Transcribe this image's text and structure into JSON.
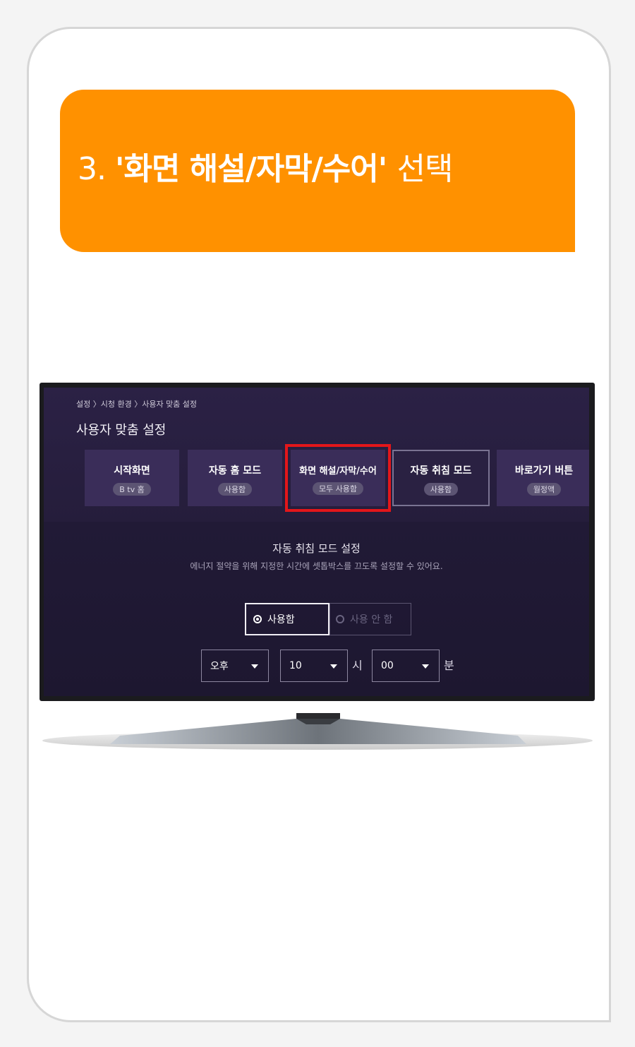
{
  "banner": {
    "number": "3. ",
    "quote_open": "'",
    "bold_text": "화면 해설/자막/수어",
    "quote_close": "' ",
    "action": "선택",
    "color": "#ff9100"
  },
  "tv": {
    "breadcrumb": "설정 〉시청 환경 〉사용자 맞춤 설정",
    "title": "사용자 맞춤 설정",
    "tiles": [
      {
        "label": "시작화면",
        "badge": "B tv 홈"
      },
      {
        "label": "자동 홈 모드",
        "badge": "사용함"
      },
      {
        "label": "화면 해설/자막/수어",
        "badge": "모두 사용함"
      },
      {
        "label": "자동 취침 모드",
        "badge": "사용함"
      },
      {
        "label": "바로가기 버튼",
        "badge": "월정액"
      }
    ],
    "highlight_color": "#e3161a",
    "detail": {
      "title": "자동 취침 모드 설정",
      "description": "에너지 절약을 위해 지정한 시간에 셋톱박스를 끄도록 설정할 수 있어요."
    },
    "radio": {
      "on_label": "사용함",
      "off_label": "사용 안 함"
    },
    "time": {
      "ampm": "오후",
      "hour": "10",
      "hour_unit": "시",
      "minute": "00",
      "minute_unit": "분"
    }
  }
}
